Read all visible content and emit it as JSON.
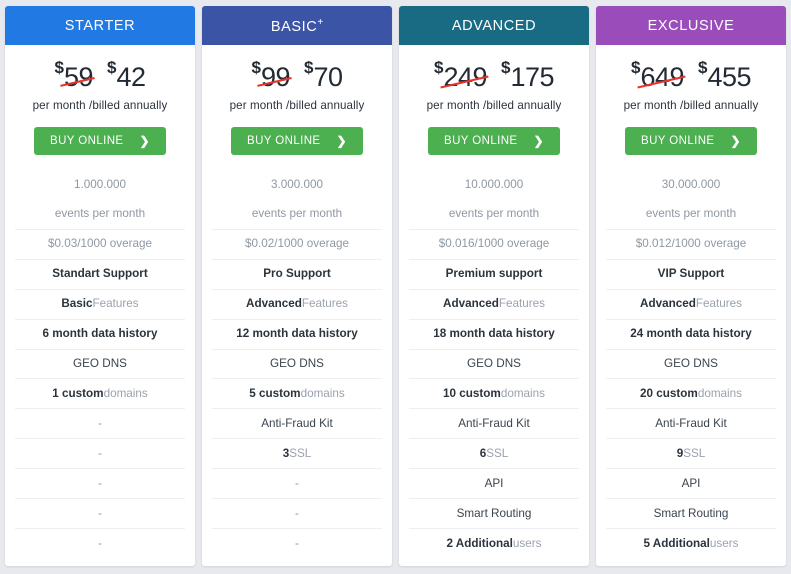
{
  "background_color": "#e7e9ee",
  "accent_button_color": "#4caf50",
  "strike_color": "#e8322a",
  "common": {
    "billing_text": "per month /billed annually",
    "buy_label": "BUY ONLINE",
    "chevron": "❯",
    "dash": "-",
    "events_label": "events per month",
    "currency_symbol": "$"
  },
  "plans": [
    {
      "name": "STARTER",
      "header_color": "#2179e3",
      "old_price": "59",
      "new_price": "42",
      "events": "1.000.000",
      "events_label": "events per month",
      "features": [
        {
          "text": "$0.03/1000 overage",
          "style": "muted"
        },
        {
          "strong": "Standart Support",
          "dim": "",
          "style": "normal"
        },
        {
          "strong": "Basic",
          "dim": " Features",
          "style": "normal"
        },
        {
          "strong": "6 month data history",
          "dim": "",
          "style": "normal"
        },
        {
          "text": "GEO DNS",
          "style": "normal"
        },
        {
          "strong": "1 custom",
          "dim": " domains",
          "style": "normal"
        },
        {
          "text": "-",
          "style": "dash"
        },
        {
          "text": "-",
          "style": "dash"
        },
        {
          "text": "-",
          "style": "dash"
        },
        {
          "text": "-",
          "style": "dash"
        },
        {
          "text": "-",
          "style": "dash"
        }
      ]
    },
    {
      "name": "BASIC+",
      "header_color": "#3b54a5",
      "old_price": "99",
      "new_price": "70",
      "events": "3.000.000",
      "events_label": "events per month",
      "features": [
        {
          "text": "$0.02/1000 overage",
          "style": "muted"
        },
        {
          "strong": "Pro Support",
          "dim": "",
          "style": "normal"
        },
        {
          "strong": "Advanced",
          "dim": " Features",
          "style": "normal"
        },
        {
          "strong": "12 month data history",
          "dim": "",
          "style": "normal"
        },
        {
          "text": "GEO DNS",
          "style": "normal"
        },
        {
          "strong": "5 custom",
          "dim": " domains",
          "style": "normal"
        },
        {
          "text": "Anti-Fraud Kit",
          "style": "normal"
        },
        {
          "strong": "3",
          "dim": " SSL",
          "style": "normal"
        },
        {
          "text": "-",
          "style": "dash"
        },
        {
          "text": "-",
          "style": "dash"
        },
        {
          "text": "-",
          "style": "dash"
        }
      ]
    },
    {
      "name": "ADVANCED",
      "header_color": "#196b84",
      "old_price": "249",
      "new_price": "175",
      "events": "10.000.000",
      "events_label": "events per month",
      "features": [
        {
          "text": "$0.016/1000 overage",
          "style": "muted"
        },
        {
          "strong": "Premium support",
          "dim": "",
          "style": "normal"
        },
        {
          "strong": "Advanced",
          "dim": " Features",
          "style": "normal"
        },
        {
          "strong": "18 month data history",
          "dim": "",
          "style": "normal"
        },
        {
          "text": "GEO DNS",
          "style": "normal"
        },
        {
          "strong": "10 custom",
          "dim": " domains",
          "style": "normal"
        },
        {
          "text": "Anti-Fraud Kit",
          "style": "normal"
        },
        {
          "strong": "6",
          "dim": " SSL",
          "style": "normal"
        },
        {
          "text": "API",
          "style": "normal"
        },
        {
          "text": "Smart Routing",
          "style": "normal"
        },
        {
          "strong": "2 Additional",
          "dim": " users",
          "style": "normal"
        }
      ]
    },
    {
      "name": "EXCLUSIVE",
      "header_color": "#9b4cbb",
      "old_price": "649",
      "new_price": "455",
      "events": "30.000.000",
      "events_label": "events per month",
      "features": [
        {
          "text": "$0.012/1000 overage",
          "style": "muted"
        },
        {
          "strong": "VIP Support",
          "dim": "",
          "style": "normal"
        },
        {
          "strong": "Advanced",
          "dim": " Features",
          "style": "normal"
        },
        {
          "strong": "24 month data history",
          "dim": "",
          "style": "normal"
        },
        {
          "text": "GEO DNS",
          "style": "normal"
        },
        {
          "strong": "20 custom",
          "dim": " domains",
          "style": "normal"
        },
        {
          "text": "Anti-Fraud Kit",
          "style": "normal"
        },
        {
          "strong": "9",
          "dim": " SSL",
          "style": "normal"
        },
        {
          "text": "API",
          "style": "normal"
        },
        {
          "text": "Smart Routing",
          "style": "normal"
        },
        {
          "strong": "5 Additional",
          "dim": " users",
          "style": "normal"
        }
      ]
    }
  ]
}
